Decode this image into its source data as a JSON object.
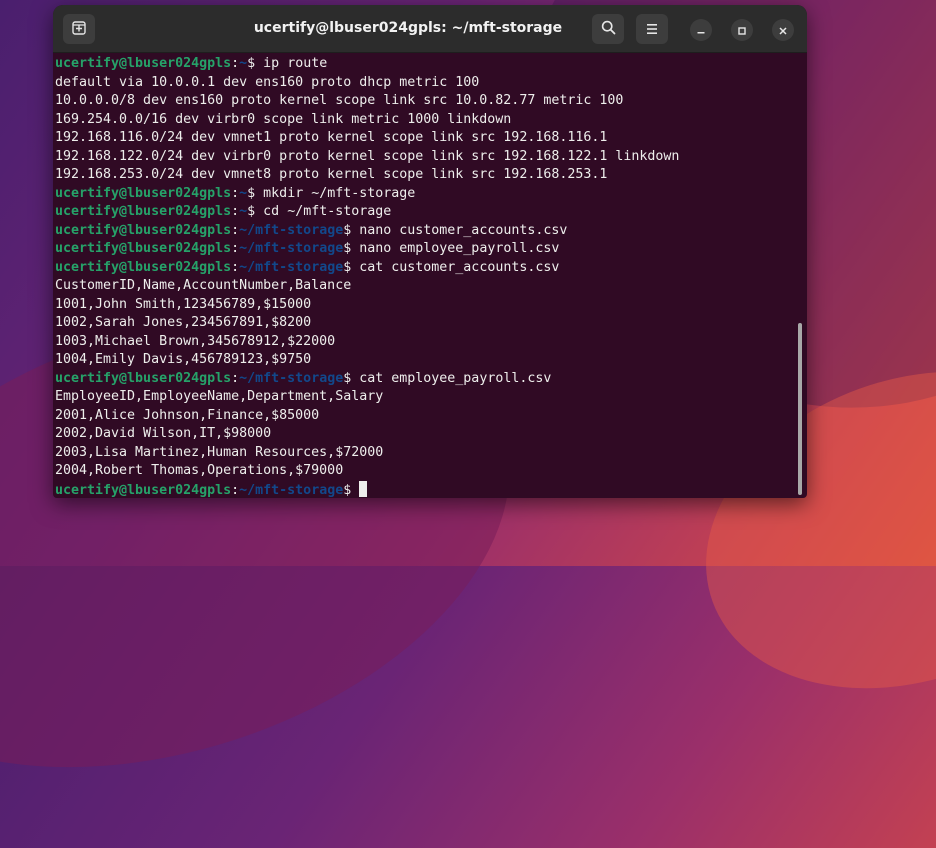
{
  "window": {
    "title": "ucertify@lbuser024gpls: ~/mft-storage"
  },
  "prompt": {
    "user": "ucertify@lbuser024gpls",
    "home_path": "~",
    "storage_path": "~/mft-storage"
  },
  "terminal": {
    "lines": [
      {
        "kind": "cmd",
        "path": "~",
        "text": "ip route"
      },
      {
        "kind": "out",
        "text": "default via 10.0.0.1 dev ens160 proto dhcp metric 100"
      },
      {
        "kind": "out",
        "text": "10.0.0.0/8 dev ens160 proto kernel scope link src 10.0.82.77 metric 100"
      },
      {
        "kind": "out",
        "text": "169.254.0.0/16 dev virbr0 scope link metric 1000 linkdown"
      },
      {
        "kind": "out",
        "text": "192.168.116.0/24 dev vmnet1 proto kernel scope link src 192.168.116.1"
      },
      {
        "kind": "out",
        "text": "192.168.122.0/24 dev virbr0 proto kernel scope link src 192.168.122.1 linkdown"
      },
      {
        "kind": "out",
        "text": "192.168.253.0/24 dev vmnet8 proto kernel scope link src 192.168.253.1"
      },
      {
        "kind": "cmd",
        "path": "~",
        "text": "mkdir ~/mft-storage"
      },
      {
        "kind": "cmd",
        "path": "~",
        "text": "cd ~/mft-storage"
      },
      {
        "kind": "cmd",
        "path": "~/mft-storage",
        "text": "nano customer_accounts.csv"
      },
      {
        "kind": "cmd",
        "path": "~/mft-storage",
        "text": "nano employee_payroll.csv"
      },
      {
        "kind": "cmd",
        "path": "~/mft-storage",
        "text": "cat customer_accounts.csv"
      },
      {
        "kind": "out",
        "text": "CustomerID,Name,AccountNumber,Balance"
      },
      {
        "kind": "out",
        "text": "1001,John Smith,123456789,$15000"
      },
      {
        "kind": "out",
        "text": "1002,Sarah Jones,234567891,$8200"
      },
      {
        "kind": "out",
        "text": "1003,Michael Brown,345678912,$22000"
      },
      {
        "kind": "out",
        "text": "1004,Emily Davis,456789123,$9750"
      },
      {
        "kind": "cmd",
        "path": "~/mft-storage",
        "text": "cat employee_payroll.csv"
      },
      {
        "kind": "out",
        "text": "EmployeeID,EmployeeName,Department,Salary"
      },
      {
        "kind": "out",
        "text": "2001,Alice Johnson,Finance,$85000"
      },
      {
        "kind": "out",
        "text": "2002,David Wilson,IT,$98000"
      },
      {
        "kind": "out",
        "text": "2003,Lisa Martinez,Human Resources,$72000"
      },
      {
        "kind": "out",
        "text": "2004,Robert Thomas,Operations,$79000"
      },
      {
        "kind": "cmd",
        "path": "~/mft-storage",
        "text": "",
        "cursor": true
      }
    ]
  },
  "icons": {
    "new_tab": "new-tab-icon",
    "search": "search-icon",
    "menu": "hamburger-menu-icon",
    "minimize": "minimize-icon",
    "maximize": "maximize-icon",
    "close": "close-icon"
  },
  "colors": {
    "terminal_bg": "#300a24",
    "prompt_user": "#26a269",
    "prompt_path": "#12488b",
    "text": "#eeeeec",
    "titlebar": "#2c2c2c"
  }
}
